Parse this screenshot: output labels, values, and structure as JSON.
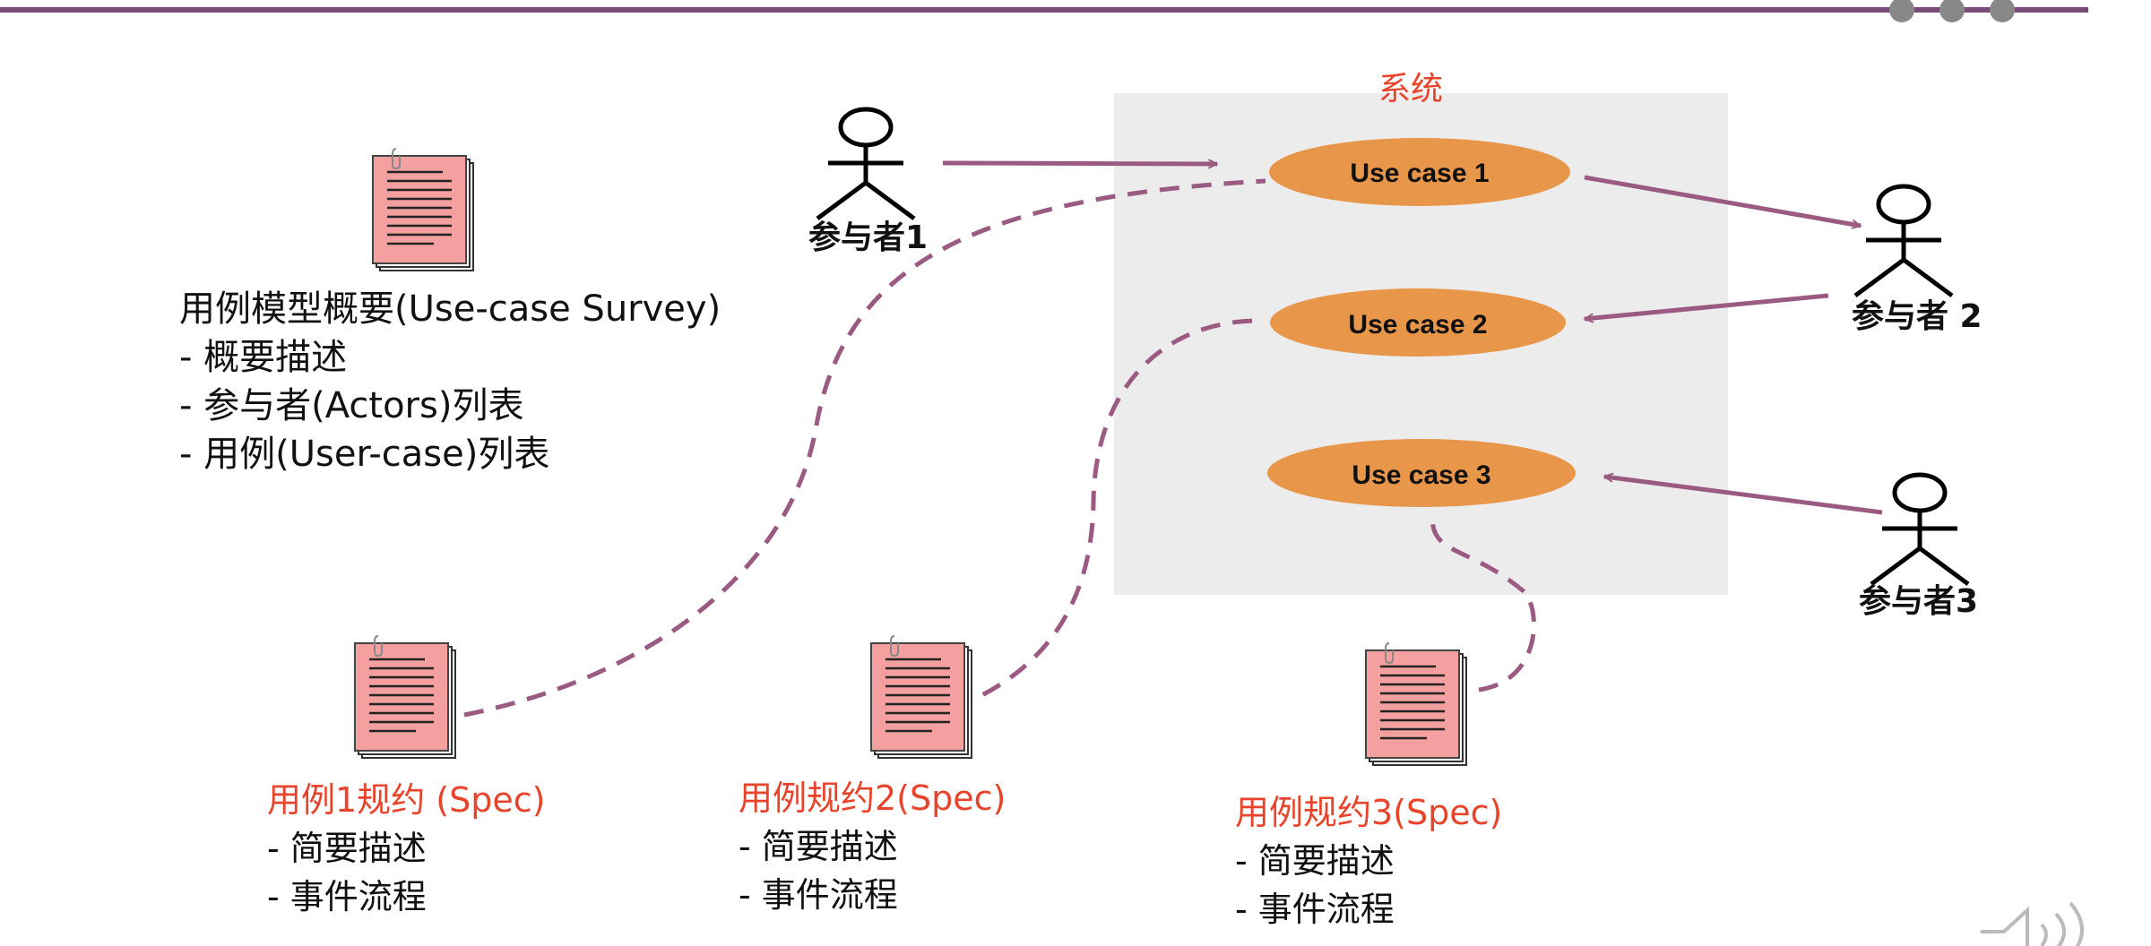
{
  "system": {
    "label": "系统"
  },
  "use_cases": [
    {
      "label": "Use case 1"
    },
    {
      "label": "Use case 2"
    },
    {
      "label": "Use case 3"
    }
  ],
  "actors": [
    {
      "label": "参与者1"
    },
    {
      "label": "参与者 2"
    },
    {
      "label": "参与者3"
    }
  ],
  "survey": {
    "title": "用例模型概要(Use-case Survey)",
    "items": [
      "- 概要描述",
      "- 参与者(Actors)列表",
      "- 用例(User-case)列表"
    ]
  },
  "specs": [
    {
      "title": "用例1规约 (Spec)",
      "items": [
        "- 简要描述",
        "- 事件流程"
      ]
    },
    {
      "title": "用例规约2(Spec)",
      "items": [
        "- 简要描述",
        "- 事件流程"
      ]
    },
    {
      "title": "用例规约3(Spec)",
      "items": [
        "- 简要描述",
        "- 事件流程"
      ]
    }
  ],
  "colors": {
    "top_rule": "#7a4a7a",
    "system_box": "#ececec",
    "use_case_fill": "#e8964a",
    "arrow": "#9a5a82",
    "spec_title": "#e8432b",
    "document": "#f4a0a0"
  },
  "icons": [
    "document-icon",
    "actor-icon",
    "speaker-icon",
    "slide-nav-dots"
  ]
}
